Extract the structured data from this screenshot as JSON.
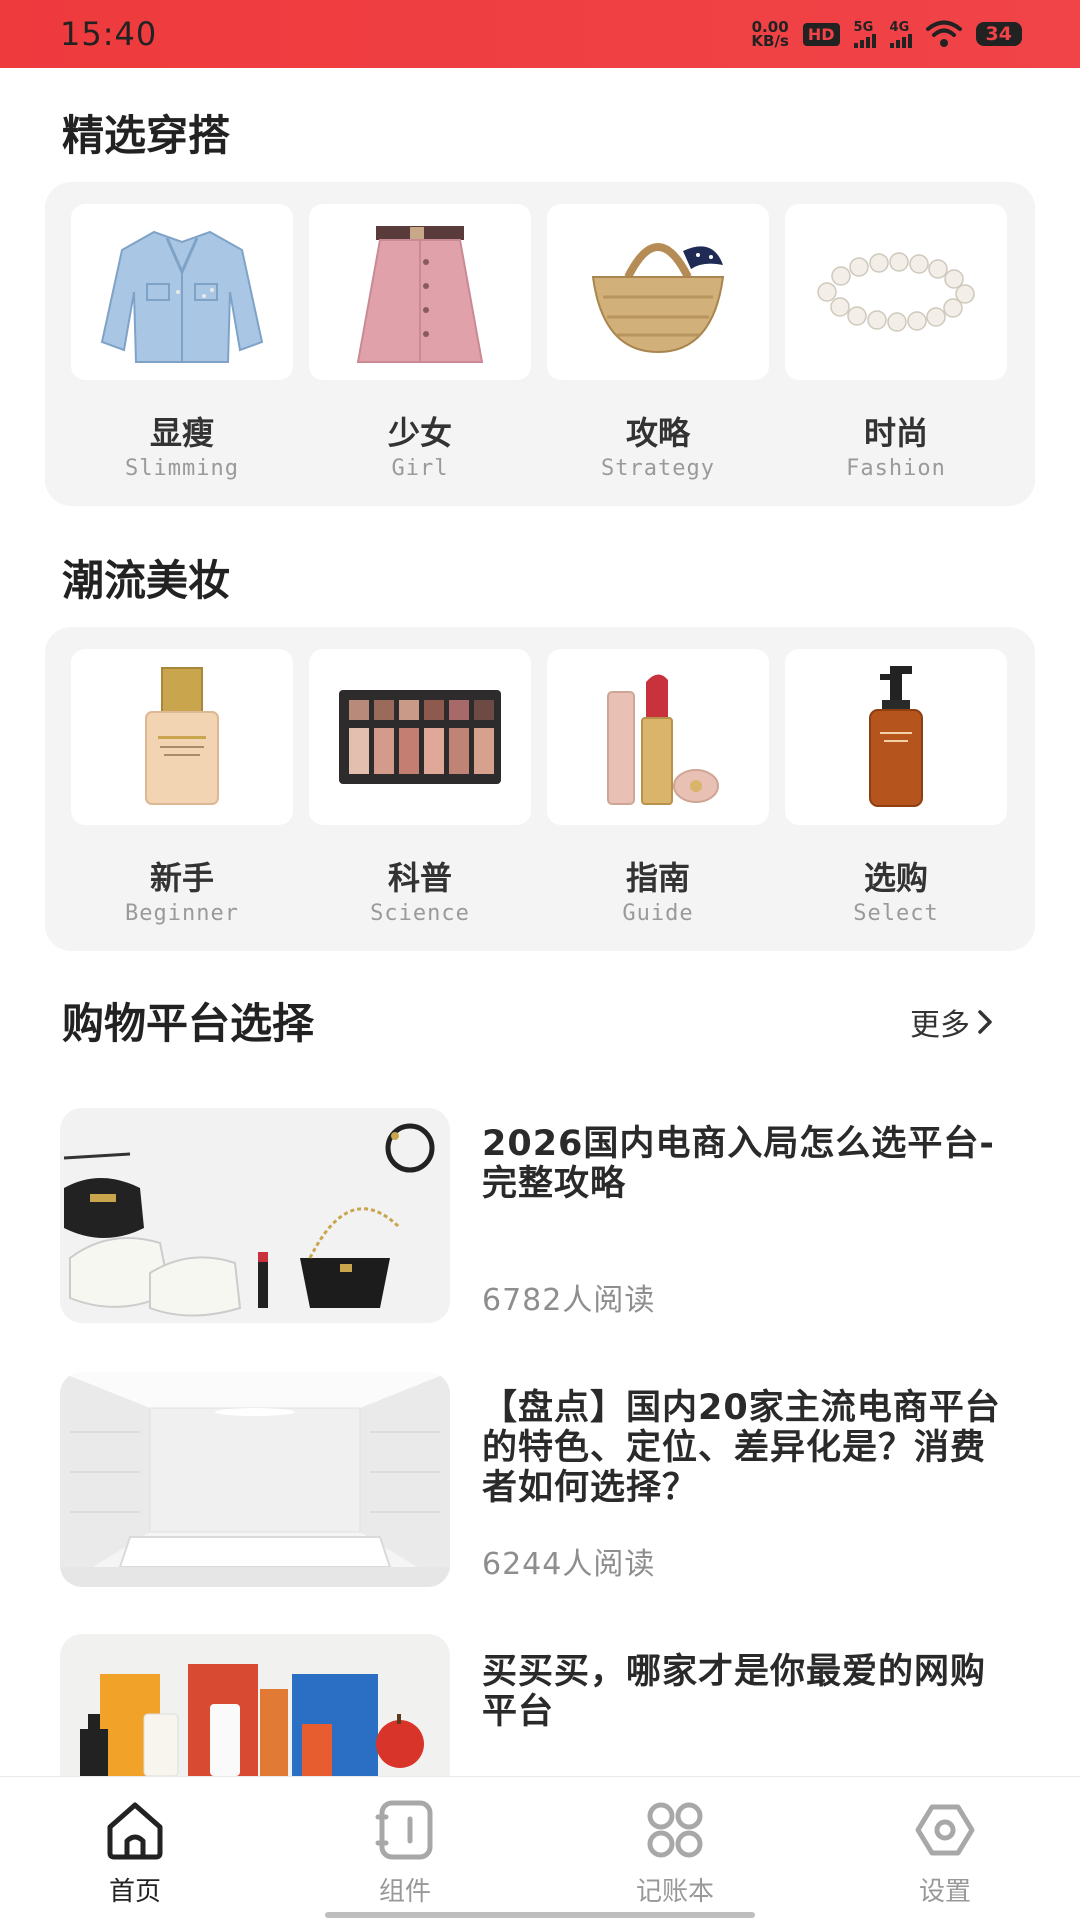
{
  "status_bar": {
    "time": "15:40",
    "net_speed_value": "0.00",
    "net_speed_unit": "KB/s",
    "hd_label": "HD",
    "signal_1_label": "5G",
    "signal_2_label": "4G",
    "battery": "34",
    "icons": [
      "hd-icon",
      "signal-5g-icon",
      "signal-4g-icon",
      "wifi-icon",
      "battery-icon"
    ]
  },
  "outfits": {
    "title": "精选穿搭",
    "items": [
      {
        "title": "显瘦",
        "subtitle": "Slimming",
        "icon": "denim-jacket-image"
      },
      {
        "title": "少女",
        "subtitle": "Girl",
        "icon": "pink-skirt-image"
      },
      {
        "title": "攻略",
        "subtitle": "Strategy",
        "icon": "straw-bag-image"
      },
      {
        "title": "时尚",
        "subtitle": "Fashion",
        "icon": "pearl-bracelet-image"
      }
    ]
  },
  "makeup": {
    "title": "潮流美妆",
    "items": [
      {
        "title": "新手",
        "subtitle": "Beginner",
        "icon": "foundation-bottle-image"
      },
      {
        "title": "科普",
        "subtitle": "Science",
        "icon": "eyeshadow-palette-image"
      },
      {
        "title": "指南",
        "subtitle": "Guide",
        "icon": "lipstick-image"
      },
      {
        "title": "选购",
        "subtitle": "Select",
        "icon": "cleansing-oil-image"
      }
    ]
  },
  "shopping": {
    "title": "购物平台选择",
    "more_label": "更多",
    "articles": [
      {
        "title": "2026国内电商入局怎么选平台-完整攻略",
        "reads": "6782人阅读"
      },
      {
        "title": "【盘点】国内20家主流电商平台的特色、定位、差异化是？消费者如何选择？",
        "reads": "6244人阅读"
      },
      {
        "title": "买买买，哪家才是你最爱的网购平台",
        "reads": ""
      }
    ]
  },
  "bottom_nav": {
    "items": [
      {
        "label": "首页",
        "icon": "home-icon",
        "active": true
      },
      {
        "label": "组件",
        "icon": "widget-icon",
        "active": false
      },
      {
        "label": "记账本",
        "icon": "grid-icon",
        "active": false
      },
      {
        "label": "设置",
        "icon": "settings-icon",
        "active": false
      }
    ]
  },
  "colors": {
    "status_bar": "#f14448",
    "panel_bg": "#f4f4f4",
    "text_primary": "#222222",
    "text_secondary": "#9a9a9a"
  }
}
